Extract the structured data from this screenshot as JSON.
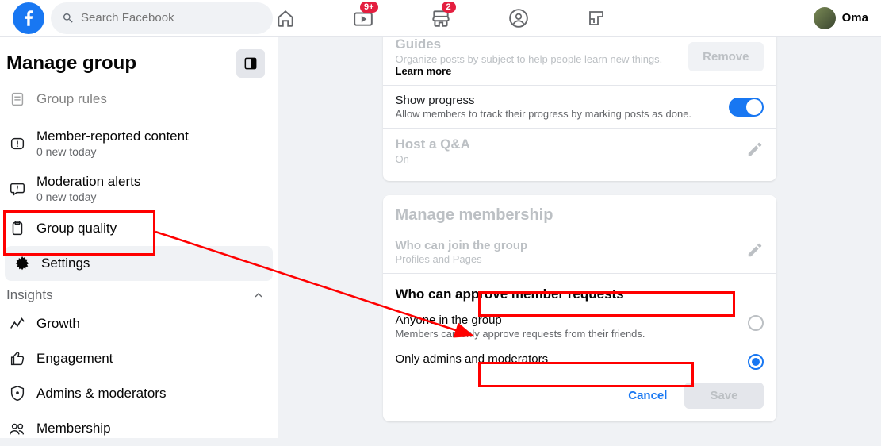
{
  "header": {
    "search_placeholder": "Search Facebook",
    "badge_watch": "9+",
    "badge_marketplace": "2",
    "user_name": "Oma"
  },
  "sidebar": {
    "title": "Manage group",
    "items": [
      {
        "label": "Group rules",
        "sub": "",
        "cut": true
      },
      {
        "label": "Member-reported content",
        "sub": "0 new today"
      },
      {
        "label": "Moderation alerts",
        "sub": "0 new today"
      },
      {
        "label": "Group quality",
        "sub": ""
      },
      {
        "label": "Settings",
        "sub": "",
        "active": true
      }
    ],
    "section": "Insights",
    "insights": [
      {
        "label": "Growth"
      },
      {
        "label": "Engagement"
      },
      {
        "label": "Admins & moderators"
      },
      {
        "label": "Membership"
      }
    ]
  },
  "guides": {
    "title": "Guides",
    "desc": "Organize posts by subject to help people learn new things. ",
    "learn": "Learn more",
    "remove": "Remove",
    "progress_title": "Show progress",
    "progress_desc": "Allow members to track their progress by marking posts as done.",
    "qa_title": "Host a Q&A",
    "qa_value": "On"
  },
  "membership": {
    "heading": "Manage membership",
    "join_title": "Who can join the group",
    "join_value": "Profiles and Pages",
    "approve_title": "Who can approve member requests",
    "opt1_title": "Anyone in the group",
    "opt1_desc": "Members can only approve requests from their friends.",
    "opt2_title": "Only admins and moderators",
    "cancel": "Cancel",
    "save": "Save"
  }
}
